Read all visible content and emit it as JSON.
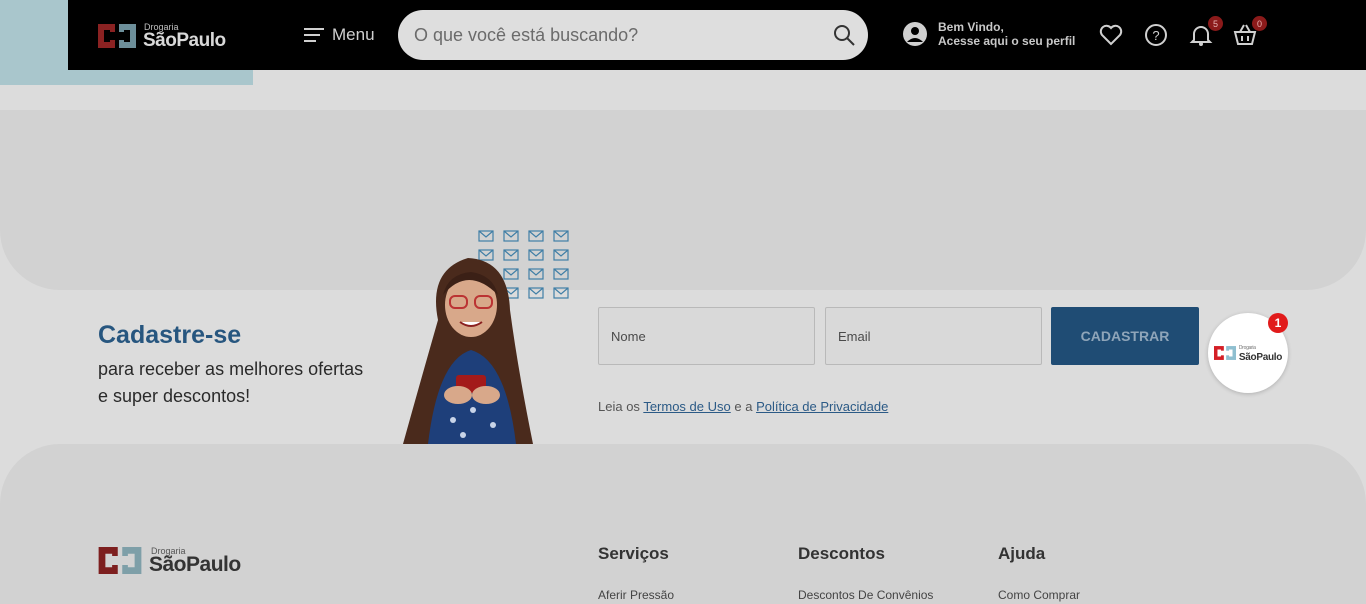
{
  "header": {
    "logo_small": "Drogaria",
    "logo_big": "SãoPaulo",
    "menu_label": "Menu",
    "search_placeholder": "O que você está buscando?",
    "profile_line1": "Bem Vindo,",
    "profile_line2": "Acesse aqui o seu perfil",
    "notifications_count": "5",
    "cart_count": "0"
  },
  "signup": {
    "title": "Cadastre-se",
    "subtitle": "para receber as melhores ofertas e super descontos!",
    "name_placeholder": "Nome",
    "email_placeholder": "Email",
    "submit_label": "CADASTRAR",
    "legal_prefix": "Leia os",
    "terms_link": "Termos de Uso",
    "legal_mid": "e a",
    "privacy_link": "Política de Privacidade"
  },
  "chat": {
    "badge_count": "1",
    "logo_small": "Drogaria",
    "logo_big": "SãoPaulo"
  },
  "footer": {
    "logo_small": "Drogaria",
    "logo_big": "SãoPaulo",
    "columns": [
      {
        "title": "Serviços",
        "link": "Aferir Pressão"
      },
      {
        "title": "Descontos",
        "link": "Descontos De Convênios"
      },
      {
        "title": "Ajuda",
        "link": "Como Comprar"
      }
    ]
  },
  "colors": {
    "header_bg": "#000000",
    "brand_blue": "#27567f",
    "button_blue": "#1f4c74",
    "badge_red": "#e11b1b"
  }
}
